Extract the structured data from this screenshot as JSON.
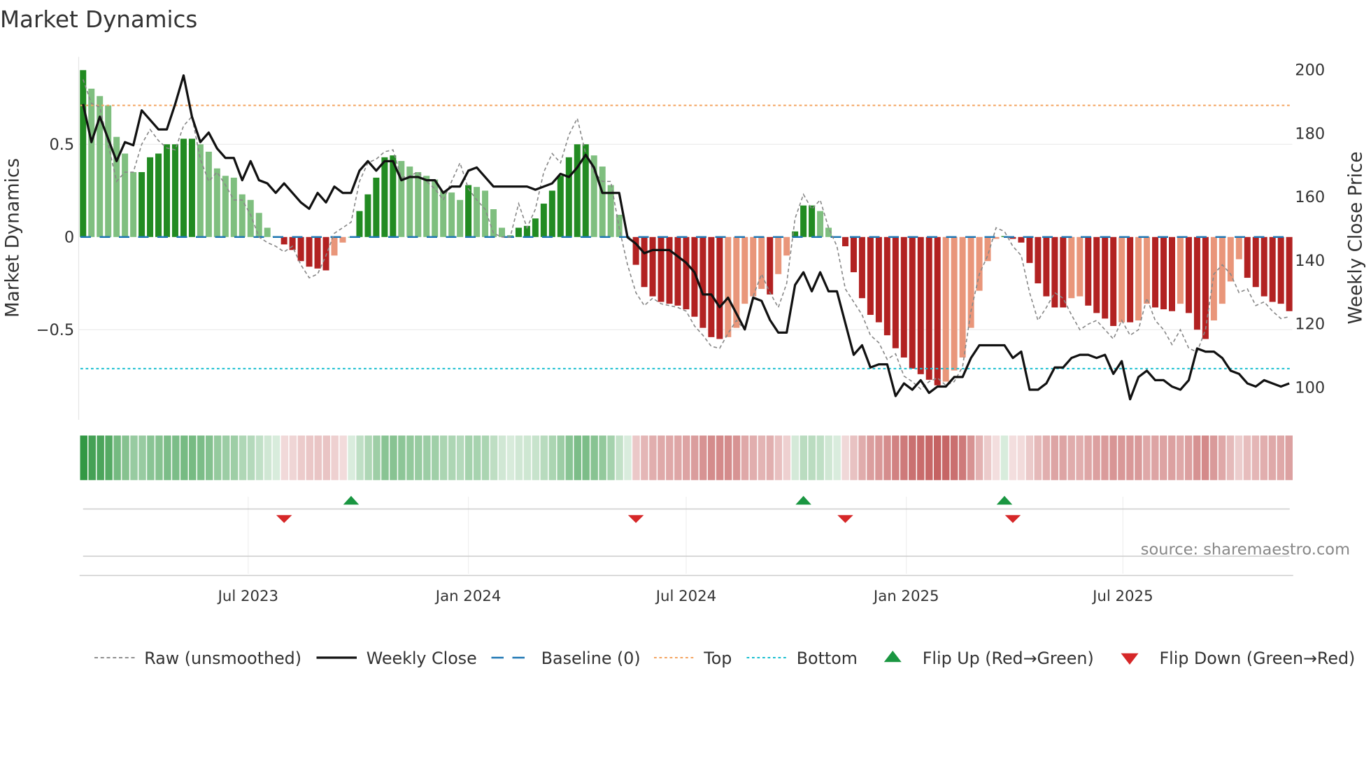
{
  "chart_data": {
    "type": "bar",
    "title": "Market Dynamics",
    "ylabel": "Market Dynamics",
    "y2label": "Weekly Close Price",
    "x_start": "2023-02-13",
    "frequency": "weekly",
    "ylim": [
      -0.98,
      0.98
    ],
    "y2lim": [
      93,
      203
    ],
    "yticks": [
      {
        "v": 0.5,
        "label": "0.5"
      },
      {
        "v": 0,
        "label": "0"
      },
      {
        "v": -0.5,
        "label": "−0.5"
      }
    ],
    "y2ticks": [
      100,
      120,
      140,
      160,
      180,
      200
    ],
    "xticks": [
      {
        "date": "2023-07-01",
        "label": "Jul 2023"
      },
      {
        "date": "2024-01-01",
        "label": "Jan 2024"
      },
      {
        "date": "2024-07-01",
        "label": "Jul 2024"
      },
      {
        "date": "2025-01-01",
        "label": "Jan 2025"
      },
      {
        "date": "2025-07-01",
        "label": "Jul 2025"
      }
    ],
    "top_level": 0.71,
    "bottom_level": -0.71,
    "baseline": 0,
    "momentum": [
      0.9,
      0.8,
      0.76,
      0.71,
      0.54,
      0.45,
      0.35,
      0.35,
      0.43,
      0.45,
      0.5,
      0.5,
      0.53,
      0.53,
      0.5,
      0.46,
      0.37,
      0.33,
      0.32,
      0.23,
      0.2,
      0.13,
      0.05,
      0.005,
      -0.04,
      -0.07,
      -0.13,
      -0.16,
      -0.17,
      -0.18,
      -0.1,
      -0.03,
      0.0,
      0.14,
      0.23,
      0.32,
      0.43,
      0.44,
      0.41,
      0.38,
      0.35,
      0.33,
      0.31,
      0.25,
      0.24,
      0.2,
      0.28,
      0.27,
      0.25,
      0.15,
      0.05,
      0.01,
      0.05,
      0.06,
      0.1,
      0.18,
      0.25,
      0.33,
      0.43,
      0.5,
      0.5,
      0.44,
      0.38,
      0.28,
      0.12,
      0.0,
      -0.15,
      -0.27,
      -0.32,
      -0.35,
      -0.36,
      -0.37,
      -0.39,
      -0.43,
      -0.49,
      -0.54,
      -0.55,
      -0.54,
      -0.49,
      -0.36,
      -0.32,
      -0.28,
      -0.31,
      -0.2,
      -0.1,
      0.03,
      0.17,
      0.17,
      0.14,
      0.05,
      0.0,
      -0.05,
      -0.19,
      -0.33,
      -0.42,
      -0.46,
      -0.53,
      -0.6,
      -0.65,
      -0.71,
      -0.74,
      -0.77,
      -0.8,
      -0.78,
      -0.72,
      -0.65,
      -0.49,
      -0.29,
      -0.13,
      -0.01,
      0.005,
      -0.01,
      -0.03,
      -0.14,
      -0.25,
      -0.32,
      -0.38,
      -0.38,
      -0.33,
      -0.32,
      -0.37,
      -0.41,
      -0.44,
      -0.48,
      -0.46,
      -0.46,
      -0.45,
      -0.36,
      -0.38,
      -0.39,
      -0.4,
      -0.36,
      -0.41,
      -0.5,
      -0.55,
      -0.45,
      -0.36,
      -0.24,
      -0.12,
      -0.22,
      -0.27,
      -0.32,
      -0.35,
      -0.36,
      -0.4
    ],
    "raw": [
      0.85,
      0.72,
      0.7,
      0.5,
      0.3,
      0.35,
      0.35,
      0.5,
      0.58,
      0.52,
      0.48,
      0.47,
      0.6,
      0.65,
      0.42,
      0.3,
      0.35,
      0.28,
      0.2,
      0.2,
      0.12,
      0.0,
      -0.03,
      -0.05,
      -0.08,
      -0.05,
      -0.15,
      -0.22,
      -0.2,
      -0.1,
      0.02,
      0.05,
      0.08,
      0.3,
      0.4,
      0.42,
      0.46,
      0.47,
      0.32,
      0.33,
      0.35,
      0.3,
      0.26,
      0.2,
      0.3,
      0.4,
      0.26,
      0.2,
      0.15,
      0.02,
      0.0,
      0.0,
      0.18,
      0.05,
      0.15,
      0.35,
      0.45,
      0.4,
      0.55,
      0.64,
      0.45,
      0.35,
      0.3,
      0.3,
      0.05,
      -0.15,
      -0.3,
      -0.37,
      -0.33,
      -0.36,
      -0.37,
      -0.38,
      -0.4,
      -0.48,
      -0.53,
      -0.59,
      -0.6,
      -0.52,
      -0.45,
      -0.5,
      -0.32,
      -0.2,
      -0.3,
      -0.38,
      -0.25,
      0.1,
      0.23,
      0.15,
      0.2,
      0.05,
      -0.05,
      -0.28,
      -0.35,
      -0.42,
      -0.53,
      -0.57,
      -0.66,
      -0.63,
      -0.75,
      -0.78,
      -0.82,
      -0.78,
      -0.76,
      -0.8,
      -0.78,
      -0.7,
      -0.4,
      -0.2,
      -0.1,
      0.05,
      0.03,
      -0.05,
      -0.1,
      -0.3,
      -0.45,
      -0.38,
      -0.3,
      -0.33,
      -0.42,
      -0.5,
      -0.47,
      -0.45,
      -0.5,
      -0.55,
      -0.45,
      -0.53,
      -0.5,
      -0.33,
      -0.45,
      -0.5,
      -0.58,
      -0.5,
      -0.6,
      -0.62,
      -0.5,
      -0.2,
      -0.15,
      -0.2,
      -0.3,
      -0.28,
      -0.37,
      -0.35,
      -0.4,
      -0.44,
      -0.43
    ],
    "close": [
      189,
      177,
      185,
      178,
      171,
      177,
      176,
      187,
      184,
      181,
      181,
      189,
      198,
      185,
      177,
      180,
      175,
      172,
      172,
      165,
      171,
      165,
      164,
      161,
      164,
      161,
      158,
      156,
      161,
      158,
      163,
      161,
      161,
      168,
      171,
      168,
      171,
      171,
      165,
      166,
      166,
      165,
      165,
      161,
      163,
      163,
      168,
      169,
      166,
      163,
      163,
      163,
      163,
      163,
      162,
      163,
      164,
      167,
      166,
      169,
      173,
      169,
      161,
      161,
      161,
      147,
      145,
      142,
      143,
      143,
      143,
      141,
      139,
      136,
      129,
      129,
      125,
      128,
      123,
      118,
      128,
      127,
      121,
      117,
      117,
      132,
      136,
      130,
      136,
      130,
      130,
      120,
      110,
      113,
      106,
      107,
      107,
      97,
      101,
      99,
      102,
      98,
      100,
      100,
      103,
      103,
      109,
      113,
      113,
      113,
      113,
      109,
      111,
      99,
      99,
      101,
      106,
      106,
      109,
      110,
      110,
      109,
      110,
      104,
      108,
      96,
      103,
      105,
      102,
      102,
      100,
      99,
      102,
      112,
      111,
      111,
      109,
      105,
      104,
      101,
      100,
      102,
      101,
      100,
      101
    ],
    "flip_up_weeks": [
      32,
      86,
      110
    ],
    "flip_down_weeks": [
      24,
      66,
      91,
      111
    ],
    "colors": {
      "strong_up": "#228b22",
      "weak_up": "#7fbf7f",
      "strong_down": "#b22222",
      "weak_down": "#e9967a",
      "close": "#111111",
      "raw": "#888888",
      "baseline": "#1f77b4",
      "top": "#f4a460",
      "bottom": "#17becf",
      "flip_up": "#1a9641",
      "flip_down": "#d62728"
    },
    "legend": {
      "position": "bottom",
      "entries": [
        "Raw (unsmoothed)",
        "Weekly Close",
        "Baseline (0)",
        "Top",
        "Bottom",
        "Flip Up (Red→Green)",
        "Flip Down (Green→Red)"
      ]
    },
    "source": "source: sharemaestro.com"
  }
}
